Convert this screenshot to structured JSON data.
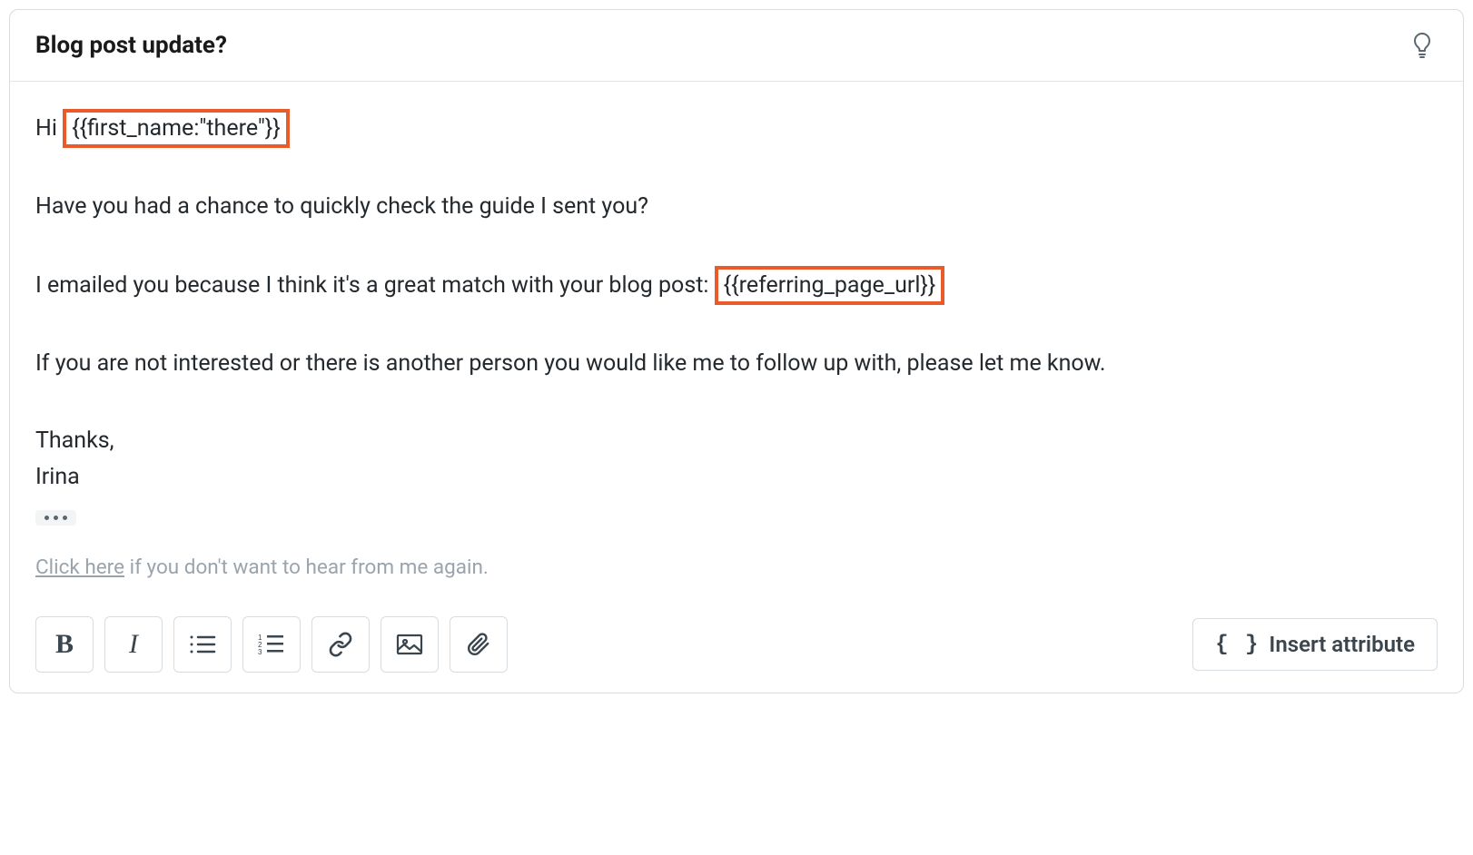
{
  "subject": "Blog post update?",
  "body": {
    "greeting_prefix": "Hi ",
    "greeting_attribute": "{{first_name:\"there\"}}",
    "line2": "Have you had a chance to quickly check the guide I sent you?",
    "line3_prefix": "I emailed you because I think it's a great match with your blog post: ",
    "line3_attribute": "{{referring_page_url}}",
    "line4": "If you are not interested or there is another person you would like me to follow up with, please let me know.",
    "signoff": "Thanks,",
    "signature": "Irina"
  },
  "unsubscribe": {
    "link_text": "Click here",
    "rest": " if you don't want to hear from me again."
  },
  "toolbar": {
    "insert_attribute_label": "Insert attribute"
  },
  "highlight_color": "#ea5a2a"
}
